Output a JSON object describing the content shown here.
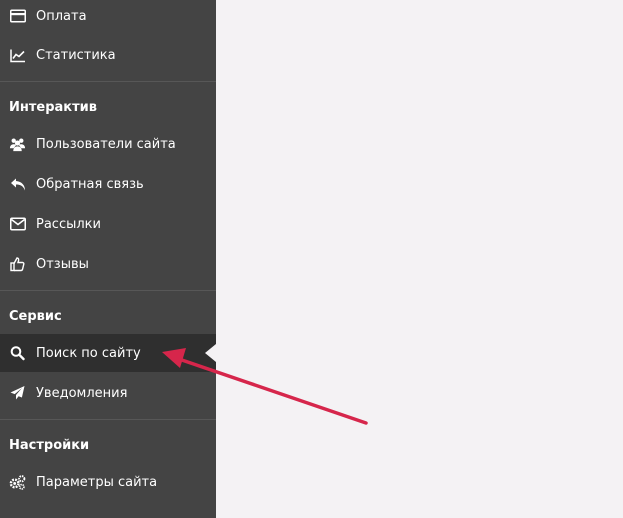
{
  "sidebar": {
    "items_top": [
      {
        "label": "Оплата",
        "icon": "credit-card-icon"
      },
      {
        "label": "Статистика",
        "icon": "line-chart-icon"
      }
    ],
    "sections": [
      {
        "title": "Интерактив",
        "items": [
          {
            "label": "Пользователи сайта",
            "icon": "users-icon"
          },
          {
            "label": "Обратная связь",
            "icon": "reply-icon"
          },
          {
            "label": "Рассылки",
            "icon": "envelope-icon"
          },
          {
            "label": "Отзывы",
            "icon": "thumbs-up-icon"
          }
        ]
      },
      {
        "title": "Сервис",
        "items": [
          {
            "label": "Поиск по сайту",
            "icon": "search-icon",
            "active": true
          },
          {
            "label": "Уведомления",
            "icon": "paper-plane-icon"
          }
        ]
      },
      {
        "title": "Настройки",
        "items": [
          {
            "label": "Параметры сайта",
            "icon": "gears-icon"
          }
        ]
      }
    ]
  },
  "colors": {
    "sidebar_bg": "#444444",
    "active_bg": "#2f2f2f",
    "content_bg": "#f4f2f4",
    "annotation_arrow": "#d6264b"
  }
}
